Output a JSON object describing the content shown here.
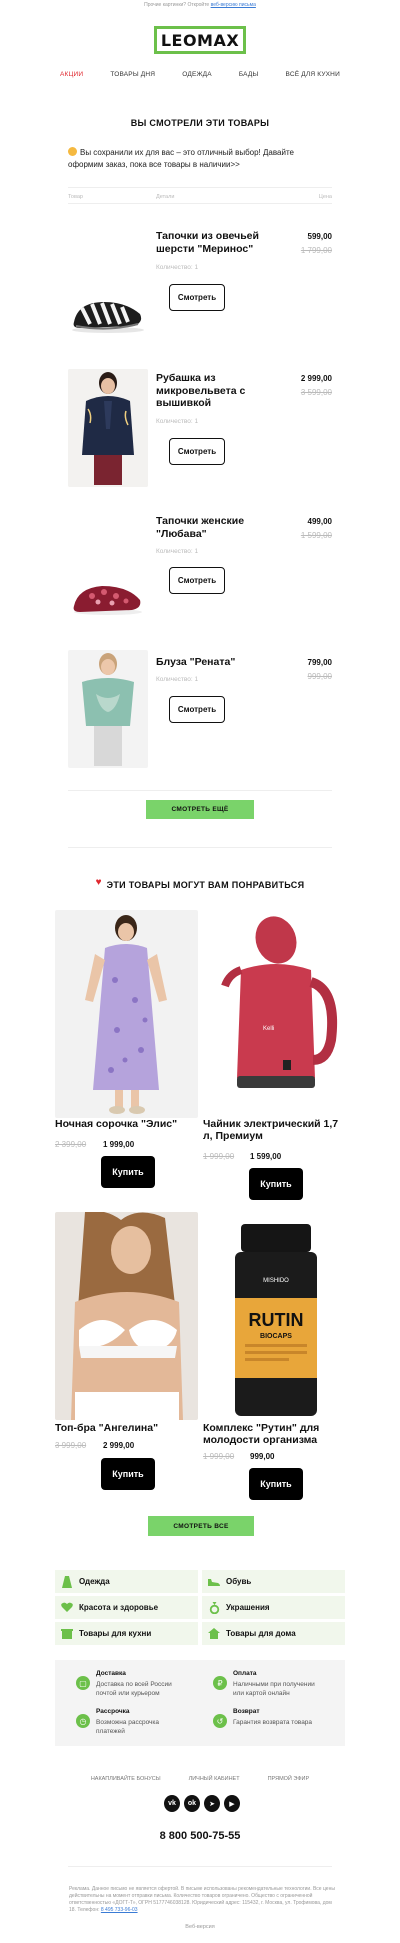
{
  "topline": {
    "text": "Прочие картинки? Откройте",
    "link": "веб-версию письма"
  },
  "logo": {
    "text": "LEOMAX",
    "color": "#6cc04a"
  },
  "nav": {
    "items": [
      "Акции",
      "Товары дня",
      "Одежда",
      "Бады",
      "Всё для кухни"
    ],
    "active_color": "#e0282f"
  },
  "viewed": {
    "title": "ВЫ СМОТРЕЛИ ЭТИ ТОВАРЫ",
    "intro": "Вы сохранили их для вас – это отличный выбор! Давайте оформим заказ, пока все товары в наличии>>",
    "headers": {
      "product": "Товар",
      "details": "Детали",
      "price": "Цена"
    },
    "qty_label": "Количество: 1",
    "button": "Смотреть",
    "items": [
      {
        "name": "Тапочки из овечьей шерсти \"Меринос\"",
        "price": "599,00",
        "old": "1 799,00"
      },
      {
        "name": "Рубашка из микровельвета с вышивкой",
        "price": "2 999,00",
        "old": "3 599,00"
      },
      {
        "name": "Тапочки женские \"Любава\"",
        "price": "499,00",
        "old": "1 599,00"
      },
      {
        "name": "Блуза \"Рената\"",
        "price": "799,00",
        "old": "999,00"
      }
    ],
    "more_button": "СМОТРЕТЬ ЕЩЁ"
  },
  "recommend": {
    "title": "ЭТИ ТОВАРЫ МОГУТ ВАМ ПОНРАВИТЬСЯ",
    "buy": "Купить",
    "items": [
      {
        "name": "Ночная сорочка \"Элис\"",
        "old": "2 399,00",
        "price": "1 999,00"
      },
      {
        "name": "Чайник электрический 1,7 л, Премиум",
        "old": "1 999,00",
        "price": "1 599,00"
      },
      {
        "name": "Топ-бра \"Ангелина\"",
        "old": "3 999,00",
        "price": "2 999,00"
      },
      {
        "name": "Комплекс \"Рутин\" для молодости организма",
        "old": "1 999,00",
        "price": "999,00"
      }
    ],
    "all_button": "СМОТРЕТЬ ВСЕ",
    "jar_brand": "MISHIDO",
    "jar_title": "RUTIN",
    "jar_sub": "BIOCAPS",
    "kettle_brand": "Kelli"
  },
  "categories": [
    "Одежда",
    "Обувь",
    "Красота и здоровье",
    "Украшения",
    "Товары для кухни",
    "Товары для дома"
  ],
  "info": [
    {
      "title": "Доставка",
      "desc": "Доставка по всей России почтой или курьером"
    },
    {
      "title": "Оплата",
      "desc": "Наличными при получении или картой онлайн"
    },
    {
      "title": "Рассрочка",
      "desc": "Возможна рассрочка платежей"
    },
    {
      "title": "Возврат",
      "desc": "Гарантия возврата товара"
    }
  ],
  "footer": {
    "links": [
      "НАКАПЛИВАЙТЕ БОНУСЫ",
      "ЛИЧНЫЙ КАБИНЕТ",
      "ПРЯМОЙ ЭФИР"
    ],
    "social": [
      "vk",
      "ok",
      "tg",
      "yt"
    ],
    "phone": "8 800 500-75-55",
    "legal": "Реклама. Данное письмо не является офертой. В письме использованы рекомендательные технологии. Все цены действительны на момент отправки письма. Количество товаров ограничено. Общество с ограниченной ответственностью «ДОГТ-Т», ОГРН 5177746038128. Юридический адрес: 115432, г. Москва, ул. Трофимова, дом 18. Телефон:",
    "legal_phone": "8 495 733-96-03",
    "web": "Веб-версия"
  }
}
